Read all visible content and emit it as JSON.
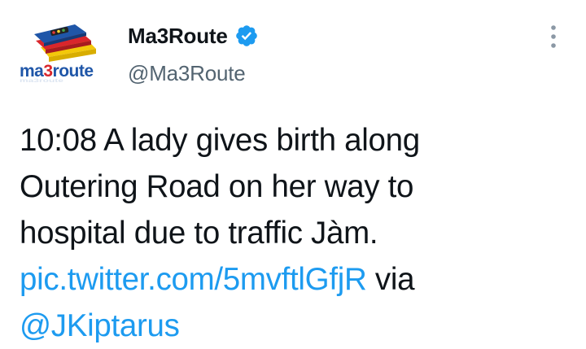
{
  "author": {
    "display_name": "Ma3Route",
    "handle": "@Ma3Route",
    "avatar_logo_text": "ma3route",
    "verified": true
  },
  "tweet": {
    "line1": "10:08 A lady gives birth along",
    "line2": "Outering Road on her way to",
    "line3": "hospital due to traffic Jàm.",
    "link_text": "pic.twitter.com/5mvftlGfjR",
    "via_text": " via",
    "mention_text": "@JKiptarus"
  },
  "icons": {
    "verified": "verified-badge-icon",
    "more": "more-options-icon"
  },
  "colors": {
    "link": "#1d9bf0",
    "text": "#0f1419",
    "secondary": "#536471",
    "logo_blue": "#1f56a8",
    "logo_red": "#d9262c",
    "logo_yellow": "#f3c80a"
  }
}
